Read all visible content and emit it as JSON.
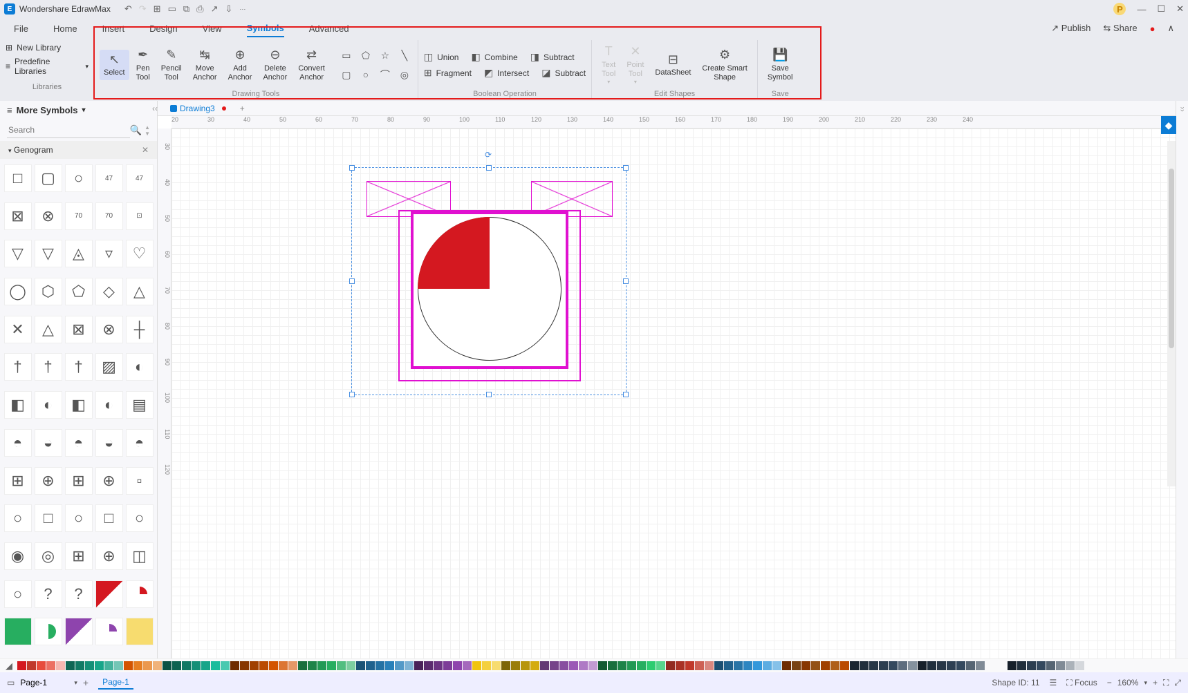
{
  "app_title": "Wondershare EdrawMax",
  "user_badge": "P",
  "qat": {
    "undo": "↶",
    "redo": "↷",
    "new": "⊞",
    "open": "▭",
    "copy": "⧉",
    "print": "⎙",
    "export": "↗",
    "import": "⇩",
    "more": "⋯"
  },
  "menubar": {
    "file": "File",
    "home": "Home",
    "insert": "Insert",
    "design": "Design",
    "view": "View",
    "symbols": "Symbols",
    "advanced": "Advanced",
    "publish": "Publish",
    "share": "Share"
  },
  "libraries": {
    "new": "New Library",
    "predef": "Predefine Libraries",
    "group": "Libraries"
  },
  "drawing_tools_group": "Drawing Tools",
  "boolean_group": "Boolean Operation",
  "edit_shapes_group": "Edit Shapes",
  "save_group": "Save",
  "tools": {
    "select": "Select",
    "pen": "Pen\nTool",
    "pencil": "Pencil\nTool",
    "move_anchor": "Move\nAnchor",
    "add_anchor": "Add\nAnchor",
    "delete_anchor": "Delete\nAnchor",
    "convert_anchor": "Convert\nAnchor"
  },
  "bool_ops": {
    "union": "Union",
    "combine": "Combine",
    "subtract": "Subtract",
    "fragment": "Fragment",
    "intersect": "Intersect",
    "subtract2": "Subtract"
  },
  "edit_shapes": {
    "text_tool": "Text\nTool",
    "point_tool": "Point\nTool",
    "datasheet": "DataSheet",
    "create_smart": "Create Smart\nShape"
  },
  "save_symbol": "Save\nSymbol",
  "left_panel": {
    "header": "More Symbols",
    "search_ph": "Search",
    "category": "Genogram"
  },
  "doc_tab": "Drawing3",
  "ruler_h": [
    "20",
    "30",
    "40",
    "50",
    "60",
    "70",
    "80",
    "90",
    "100",
    "110",
    "120",
    "130",
    "140",
    "150",
    "160",
    "170",
    "180",
    "190",
    "200",
    "210",
    "220",
    "230",
    "240"
  ],
  "ruler_v": [
    "30",
    "40",
    "50",
    "60",
    "70",
    "80",
    "90",
    "100",
    "110",
    "120"
  ],
  "palette": [
    "#d41820",
    "#c0392b",
    "#e74c3c",
    "#ec7063",
    "#f5b7b1",
    "#0e6655",
    "#117a65",
    "#148f77",
    "#17a589",
    "#45b39d",
    "#73c6b6",
    "#d35400",
    "#e67e22",
    "#eb984e",
    "#f0b27a",
    "#0b5345",
    "#0e6251",
    "#117864",
    "#148f77",
    "#17a589",
    "#1abc9c",
    "#48c9b0",
    "#6e2c00",
    "#873600",
    "#a04000",
    "#ba4a00",
    "#d35400",
    "#dc7633",
    "#e59866",
    "#196f3d",
    "#1e8449",
    "#229954",
    "#27ae60",
    "#52be80",
    "#7dcea0",
    "#1a5276",
    "#1f618d",
    "#2471a3",
    "#2980b9",
    "#5499c7",
    "#7fb3d5",
    "#4a235a",
    "#5b2c6f",
    "#6c3483",
    "#7d3c98",
    "#8e44ad",
    "#a569bd",
    "#f1c40f",
    "#f4d03f",
    "#f7dc6f",
    "#7d6608",
    "#9a7d0a",
    "#b7950b",
    "#d4ac0d",
    "#633974",
    "#76448a",
    "#884ea0",
    "#9b59b6",
    "#af7ac5",
    "#c39bd3",
    "#145a32",
    "#196f3d",
    "#1d8348",
    "#229954",
    "#27ae60",
    "#2ecc71",
    "#58d68d",
    "#922b21",
    "#a93226",
    "#c0392b",
    "#cd6155",
    "#d98880",
    "#1b4f72",
    "#21618c",
    "#2874a6",
    "#2e86c1",
    "#3498db",
    "#5dade2",
    "#85c1e9",
    "#6e2c00",
    "#784212",
    "#873600",
    "#935116",
    "#a04000",
    "#af601a",
    "#ba4a00",
    "#1b2631",
    "#212f3c",
    "#273746",
    "#2c3e50",
    "#34495e",
    "#5d6d7e",
    "#85929e",
    "#17202a",
    "#212f3d",
    "#283747",
    "#2e4053",
    "#34495e",
    "#566573",
    "#808b96"
  ],
  "mono": [
    "#17202a",
    "#212f3c",
    "#2c3e50",
    "#34495e",
    "#566573",
    "#808b96",
    "#abb2b9",
    "#d5d8dc"
  ],
  "status": {
    "page_sel": "Page-1",
    "page_tab": "Page-1",
    "shape_id": "Shape ID: 11",
    "focus": "Focus",
    "zoom": "160%"
  }
}
